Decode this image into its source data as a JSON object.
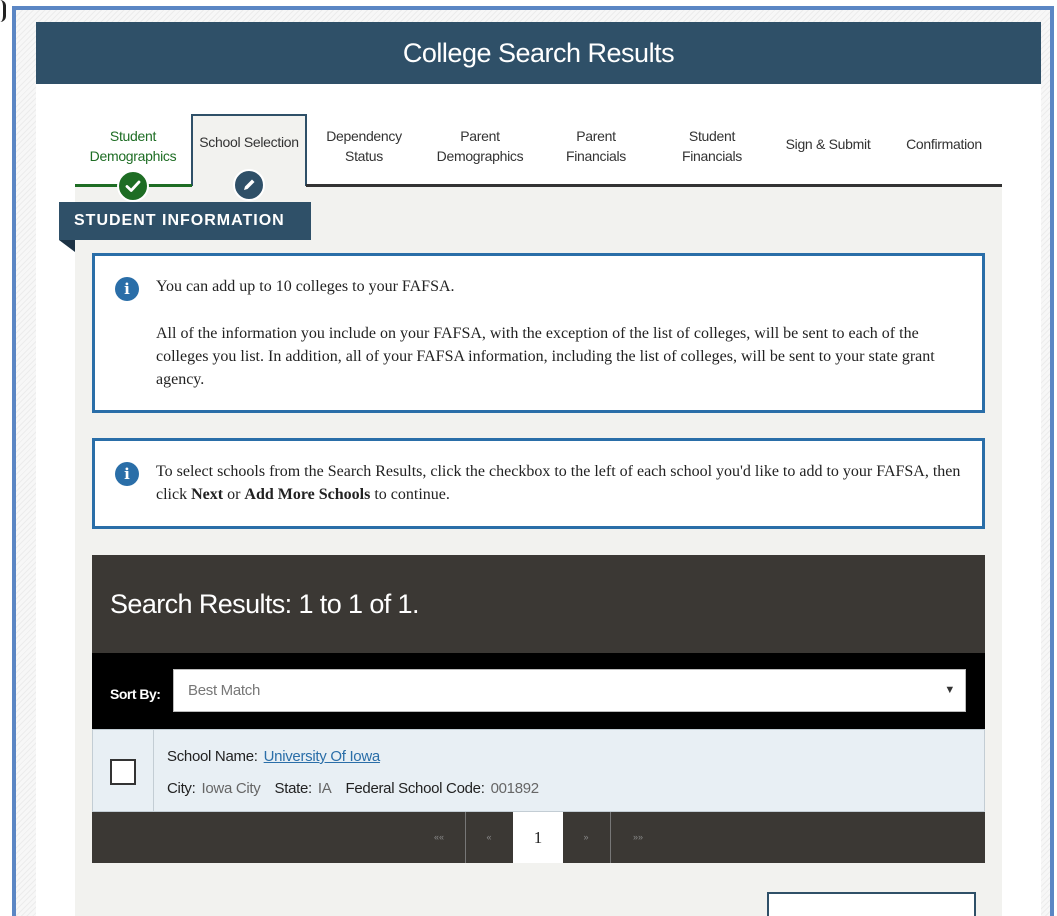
{
  "header": {
    "title": "College Search Results"
  },
  "steps": [
    {
      "label_line1": "Student",
      "label_line2": "Demographics",
      "state": "complete"
    },
    {
      "label": "School Selection",
      "state": "current"
    },
    {
      "label_line1": "Dependency",
      "label_line2": "Status"
    },
    {
      "label_line1": "Parent",
      "label_line2": "Demographics"
    },
    {
      "label_line1": "Parent",
      "label_line2": "Financials"
    },
    {
      "label_line1": "Student",
      "label_line2": "Financials"
    },
    {
      "label": "Sign & Submit"
    },
    {
      "label": "Confirmation"
    }
  ],
  "section": {
    "title": "STUDENT INFORMATION"
  },
  "info_box_1": {
    "text_1": "You can add up to 10 colleges to your FAFSA.",
    "text_2": "All of the information you include on your FAFSA, with the exception of the list of colleges, will be sent to each of the colleges you list. In addition, all of your FAFSA information, including the list of colleges, will be sent to your state grant agency."
  },
  "info_box_2": {
    "text_before": "To select schools from the Search Results, click the checkbox to the left of each school you'd like to add to your FAFSA, then click ",
    "bold_1": "Next",
    "text_mid": " or ",
    "bold_2": "Add More Schools",
    "text_after": " to continue."
  },
  "icons": {
    "info": "i",
    "check": "check-icon",
    "pencil": "pencil-icon"
  },
  "results": {
    "heading": "Search Results: 1 to 1 of 1.",
    "sort_label": "Sort By:",
    "sort_value": "Best Match",
    "rows": [
      {
        "name_label": "School Name:",
        "name": "University Of Iowa",
        "city_label": "City:",
        "city": "Iowa City",
        "state_label": "State:",
        "state": "IA",
        "code_label": "Federal School Code:",
        "code": "001892"
      }
    ]
  },
  "pagination": {
    "first": "««",
    "prev": "«",
    "current": "1",
    "next": "»",
    "last": "»»"
  },
  "colors": {
    "header": "#2f5068",
    "complete": "#1e6d24",
    "accent": "#2a6ea8",
    "results_bg": "#3b3834"
  }
}
